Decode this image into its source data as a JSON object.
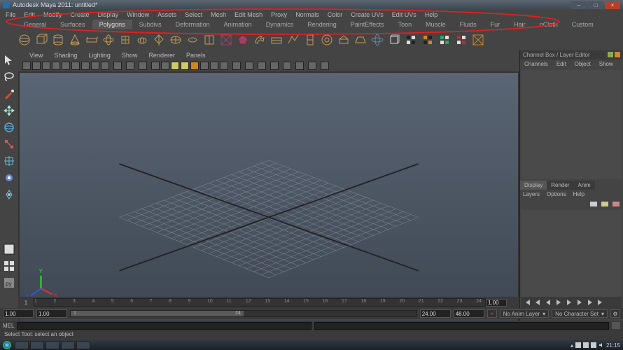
{
  "window": {
    "title": "Autodesk Maya 2011: untitled*"
  },
  "menubar": [
    "File",
    "Edit",
    "Modify",
    "Create",
    "Display",
    "Window",
    "Assets",
    "Select",
    "Mesh",
    "Edit Mesh",
    "Proxy",
    "Normals",
    "Color",
    "Create UVs",
    "Edit UVs",
    "Help"
  ],
  "shelf_tabs": [
    "General",
    "Surfaces",
    "Polygons",
    "Subdivs",
    "Deformation",
    "Animation",
    "Dynamics",
    "Rendering",
    "PaintEffects",
    "Toon",
    "Muscle",
    "Fluids",
    "Fur",
    "Hair",
    "nCloth",
    "Custom"
  ],
  "shelf_active_index": 2,
  "panel_menubar": [
    "View",
    "Shading",
    "Lighting",
    "Show",
    "Renderer",
    "Panels"
  ],
  "channel_box": {
    "title": "Channel Box / Layer Editor",
    "tabs": [
      "Channels",
      "Edit",
      "Object",
      "Show"
    ],
    "layer_tabs": [
      "Display",
      "Render",
      "Anim"
    ],
    "layer_active": 0,
    "layer_menu": [
      "Layers",
      "Options",
      "Help"
    ]
  },
  "timeslider": {
    "start": "1",
    "end": "1.00",
    "ticks": [
      "1",
      "2",
      "3",
      "4",
      "5",
      "6",
      "7",
      "8",
      "9",
      "10",
      "11",
      "12",
      "13",
      "14",
      "15",
      "16",
      "17",
      "18",
      "19",
      "20",
      "21",
      "22",
      "23",
      "24"
    ]
  },
  "rangeslider": {
    "start_outer": "1.00",
    "start_inner": "1.00",
    "bar_start": "1",
    "bar_end": "24",
    "end_inner": "24.00",
    "end_outer": "48.00",
    "anim_layer": "No Anim Layer",
    "char_set": "No Character Set"
  },
  "cmdline": {
    "label": "MEL"
  },
  "helpline": "Select Tool: select an object",
  "systray": {
    "clock": "21:15"
  },
  "colors": {
    "annotation": "#dd2222",
    "shelf_gold": "#c49a5a"
  }
}
